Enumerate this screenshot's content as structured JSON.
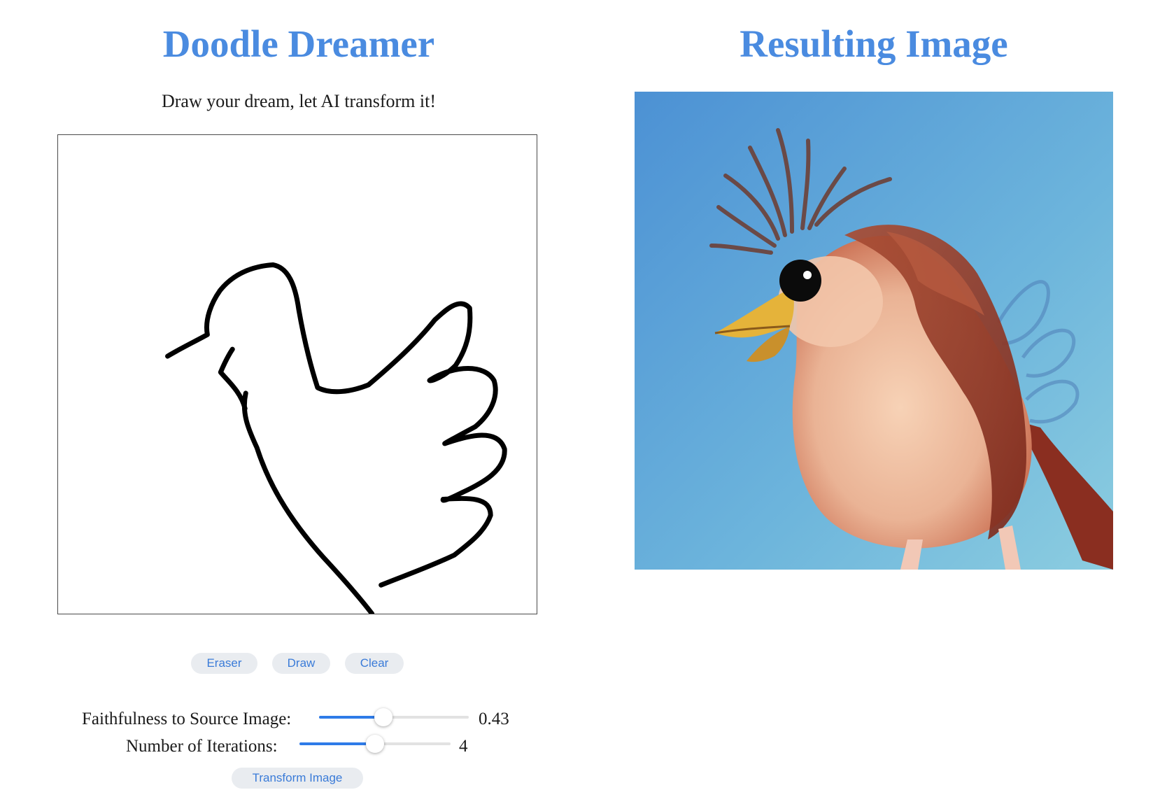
{
  "left_panel": {
    "title": "Doodle Dreamer",
    "subtitle": "Draw your dream, let AI transform it!"
  },
  "right_panel": {
    "title": "Resulting Image"
  },
  "toolbar": {
    "eraser_label": "Eraser",
    "draw_label": "Draw",
    "clear_label": "Clear"
  },
  "controls": {
    "faithfulness": {
      "label": "Faithfulness to Source Image:",
      "value": "0.43",
      "fraction": 0.43
    },
    "iterations": {
      "label": "Number of Iterations:",
      "value": "4",
      "fraction": 0.5
    },
    "transform_label": "Transform Image"
  },
  "colors": {
    "title": "#4a8be0",
    "button_text": "#3a7bd8",
    "button_bg": "#e9ecf0",
    "slider_fill": "#2e7be8",
    "result_background": "#5fa8d8"
  }
}
